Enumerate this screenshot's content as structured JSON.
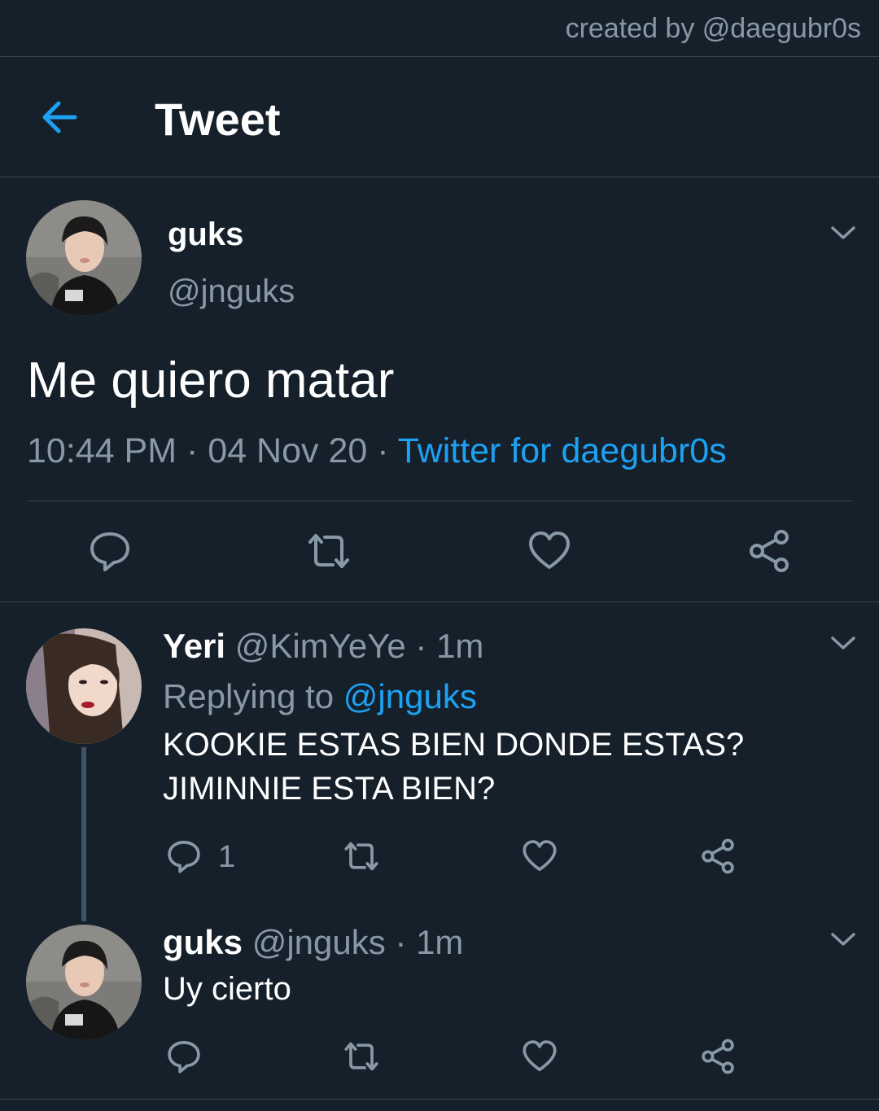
{
  "credit": "created by @daegubr0s",
  "header": {
    "title": "Tweet"
  },
  "main_tweet": {
    "name": "guks",
    "handle": "@jnguks",
    "text": "Me quiero matar",
    "time": "10:44 PM",
    "date": "04 Nov 20",
    "source": "Twitter for daegubr0s",
    "separator": " · "
  },
  "replies": [
    {
      "name": "Yeri",
      "handle": "@KimYeYe · 1m",
      "replying_prefix": "Replying to ",
      "replying_to": "@jnguks",
      "line1": "KOOKIE ESTAS BIEN DONDE ESTAS?",
      "line2": "JIMINNIE ESTA BIEN?",
      "reply_count": "1"
    },
    {
      "name": "guks",
      "handle": "@jnguks · 1m",
      "line1": "Uy cierto"
    }
  ],
  "colors": {
    "background": "#15202b",
    "accent": "#1da1f2",
    "muted": "#8899a6",
    "border": "#38444d"
  },
  "icons": [
    "back-arrow-icon",
    "chevron-down-icon",
    "reply-icon",
    "retweet-icon",
    "like-icon",
    "share-icon"
  ]
}
